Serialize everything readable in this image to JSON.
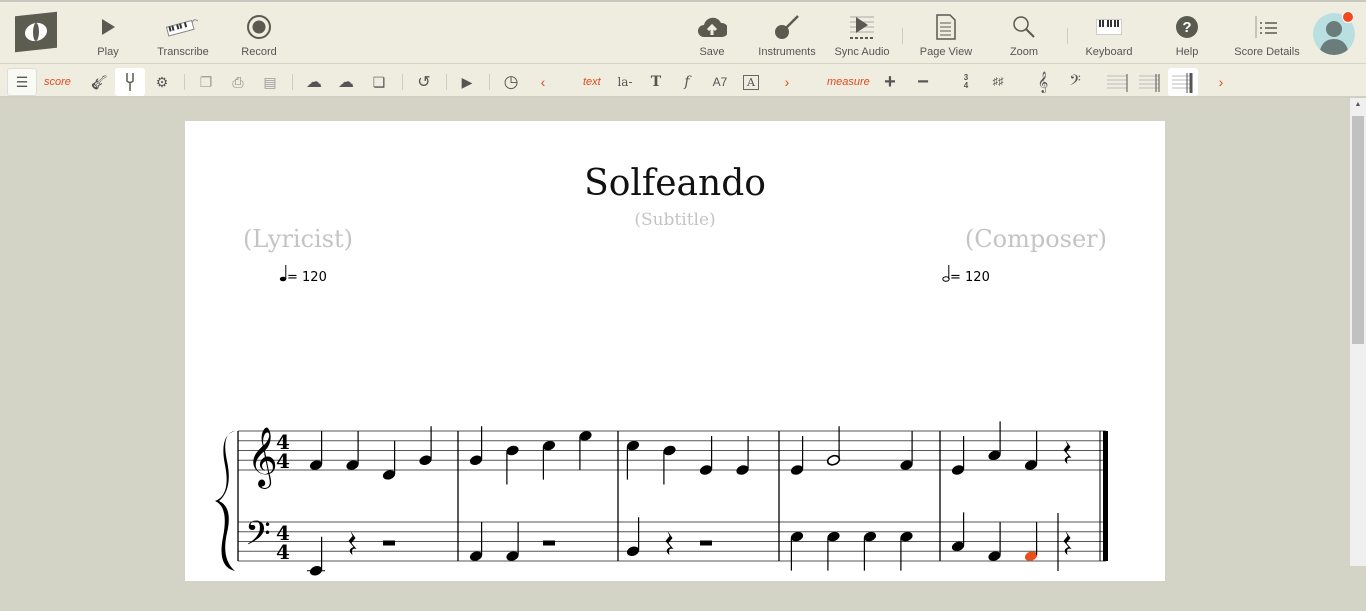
{
  "toolbar": {
    "play": "Play",
    "transcribe": "Transcribe",
    "record": "Record",
    "save": "Save",
    "instruments": "Instruments",
    "sync_audio": "Sync Audio",
    "page_view": "Page View",
    "zoom": "Zoom",
    "keyboard": "Keyboard",
    "help": "Help",
    "score_details": "Score Details"
  },
  "subtoolbar": {
    "score": "score",
    "text": "text",
    "lyric": "la-",
    "text_T": "T",
    "dynamic": "f",
    "chord": "A7",
    "box": "A",
    "measure": "measure",
    "prev": "‹",
    "next": "›",
    "next2": "›"
  },
  "colors": {
    "accent": "#e04a1e",
    "bg": "#efede0",
    "icon": "#5a5a50"
  },
  "score": {
    "title": "Solfeando",
    "subtitle": "(Subtitle)",
    "lyricist": "(Lyricist)",
    "composer": "(Composer)",
    "tempo1": "= 120",
    "tempo2": "= 120",
    "time_signature": [
      "4",
      "4"
    ],
    "measures": [
      {
        "treble": [
          {
            "p": "F4",
            "d": "q"
          },
          {
            "p": "F4",
            "d": "q"
          },
          {
            "p": "D4",
            "d": "q"
          },
          {
            "p": "G4",
            "d": "q"
          }
        ],
        "bass": [
          {
            "p": "E2",
            "d": "q"
          },
          {
            "r": "q"
          },
          {
            "r": "h"
          }
        ]
      },
      {
        "treble": [
          {
            "p": "G4",
            "d": "q"
          },
          {
            "p": "B4",
            "d": "q"
          },
          {
            "p": "C5",
            "d": "q"
          },
          {
            "p": "E5",
            "d": "q"
          }
        ],
        "bass": [
          {
            "p": "A2",
            "d": "q"
          },
          {
            "p": "A2",
            "d": "q"
          },
          {
            "r": "h"
          }
        ]
      },
      {
        "treble": [
          {
            "p": "C5",
            "d": "q"
          },
          {
            "p": "B4",
            "d": "q"
          },
          {
            "p": "E4",
            "d": "q"
          },
          {
            "p": "E4",
            "d": "q"
          }
        ],
        "bass": [
          {
            "p": "B2",
            "d": "q"
          },
          {
            "r": "q"
          },
          {
            "r": "h"
          }
        ]
      },
      {
        "treble": [
          {
            "p": "E4",
            "d": "q"
          },
          {
            "p": "G4",
            "d": "h"
          },
          {
            "p": "F4",
            "d": "q"
          }
        ],
        "bass": [
          {
            "p": "E3",
            "d": "q"
          },
          {
            "p": "E3",
            "d": "q"
          },
          {
            "p": "E3",
            "d": "q"
          },
          {
            "p": "E3",
            "d": "q"
          }
        ]
      },
      {
        "treble": [
          {
            "p": "E4",
            "d": "q"
          },
          {
            "p": "A4",
            "d": "q"
          },
          {
            "p": "F4",
            "d": "q"
          },
          {
            "r": "q"
          }
        ],
        "bass": [
          {
            "p": "C3",
            "d": "q"
          },
          {
            "p": "A2",
            "d": "q"
          },
          {
            "p": "A2",
            "d": "q",
            "selected": true
          },
          {
            "r": "q"
          }
        ]
      }
    ]
  }
}
